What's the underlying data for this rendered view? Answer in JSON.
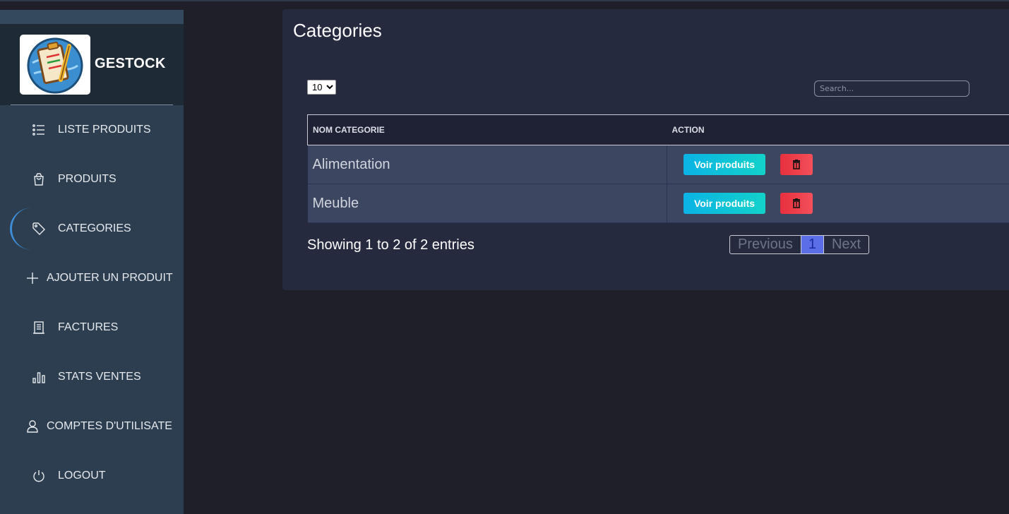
{
  "brand": {
    "name": "GESTOCK",
    "logo_icon": "clipboard-globe-logo"
  },
  "sidebar": {
    "items": [
      {
        "label": "LISTE PRODUITS",
        "icon": "list-icon"
      },
      {
        "label": "PRODUITS",
        "icon": "shopping-bag-icon"
      },
      {
        "label": "CATEGORIES",
        "icon": "tag-icon",
        "active": true
      },
      {
        "label": "AJOUTER UN PRODUIT",
        "icon": "plus-icon"
      },
      {
        "label": "FACTURES",
        "icon": "invoice-icon"
      },
      {
        "label": "STATS VENTES",
        "icon": "bar-chart-icon"
      },
      {
        "label": "COMPTES D'UTILISATE",
        "icon": "user-icon"
      },
      {
        "label": "LOGOUT",
        "icon": "power-icon"
      }
    ]
  },
  "main": {
    "title": "Categories",
    "page_length": "10",
    "search_placeholder": "Search...",
    "table": {
      "columns": [
        "NOM CATEGORIE",
        "ACTION"
      ],
      "rows": [
        {
          "name": "Alimentation",
          "view_label": "Voir produits"
        },
        {
          "name": "Meuble",
          "view_label": "Voir produits"
        }
      ]
    },
    "info": "Showing 1 to 2 of 2 entries",
    "pagination": {
      "previous": "Previous",
      "current": "1",
      "next": "Next"
    }
  },
  "colors": {
    "background": "#1f1f29",
    "sidebar": "#2c3e50",
    "card": "#262a3e",
    "view_button": "#0bb3e5",
    "delete_button": "#e7303e",
    "page_current": "#5b6ee8"
  }
}
